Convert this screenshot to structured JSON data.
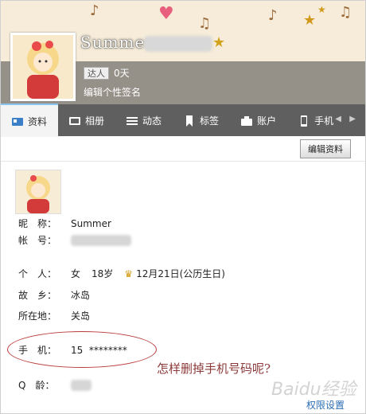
{
  "profile": {
    "name": "Summer",
    "rank_badge": "达人",
    "days": "0天",
    "signature_prompt": "编辑个性签名"
  },
  "tabs": [
    {
      "label": "资料",
      "icon": "profile-card-icon",
      "active": true
    },
    {
      "label": "相册",
      "icon": "album-icon"
    },
    {
      "label": "动态",
      "icon": "list-icon"
    },
    {
      "label": "标签",
      "icon": "bookmark-icon"
    },
    {
      "label": "账户",
      "icon": "briefcase-icon"
    },
    {
      "label": "手机",
      "icon": "phone-icon"
    }
  ],
  "toolbar": {
    "edit_profile_label": "编辑资料"
  },
  "fields": {
    "nickname_label": "昵　称：",
    "nickname_value": "Summer",
    "account_label": "帐　号：",
    "personal_label": "个　人：",
    "gender": "女",
    "age": "18岁",
    "birthday": "12月21日(公历生日)",
    "hometown_label": "故　乡：",
    "hometown_value": "冰岛",
    "location_label": "所在地：",
    "location_value": "关岛",
    "phone_label": "手　机：",
    "phone_value": "15  ********",
    "qage_label": "Q　龄："
  },
  "annotation": {
    "question": "怎样删掉手机号码呢?"
  },
  "footer": {
    "permission_link": "权限设置"
  },
  "watermark": "Baidu经验",
  "colors": {
    "tab_bar": "#5f5f5f",
    "active_tab": "#f4f4f4",
    "annotation_red": "#b93b3b",
    "link_blue": "#2a6db5"
  }
}
